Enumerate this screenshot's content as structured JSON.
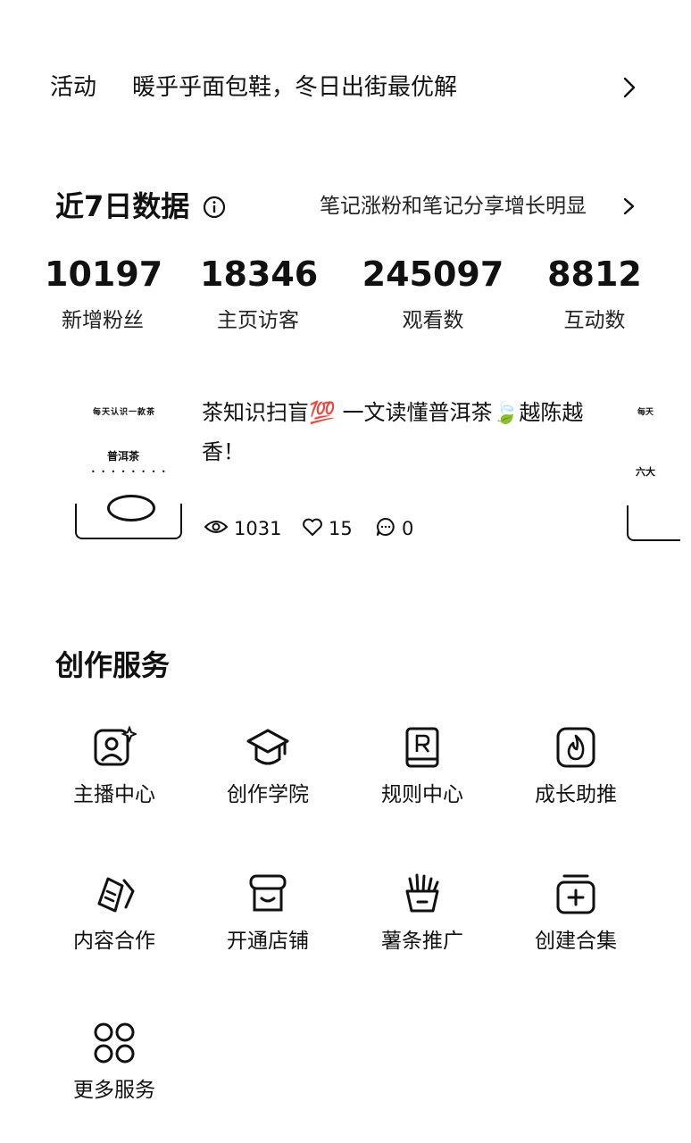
{
  "activity": {
    "tag": "活动",
    "text": "暖乎乎面包鞋，冬日出街最优解"
  },
  "data_panel": {
    "title": "近7日数据",
    "hint": "笔记涨粉和笔记分享增长明显",
    "stats": [
      {
        "value": "10197",
        "label": "新增粉丝"
      },
      {
        "value": "18346",
        "label": "主页访客"
      },
      {
        "value": "245097",
        "label": "观看数"
      },
      {
        "value": "8812",
        "label": "互动数"
      }
    ]
  },
  "note": {
    "title": "茶知识扫盲💯 一文读懂普洱茶🍃越陈越香！",
    "thumb_line1": "每天认识一款茶",
    "thumb_line2": "普洱茶",
    "thumb_dots": "• • • •  • • • •",
    "views": "1031",
    "likes": "15",
    "comments": "0",
    "next_thumb_line1": "每天",
    "next_thumb_line2": "六大"
  },
  "services": {
    "title": "创作服务",
    "items": [
      {
        "label": "主播中心",
        "icon": "host-center-icon"
      },
      {
        "label": "创作学院",
        "icon": "graduation-cap-icon"
      },
      {
        "label": "规则中心",
        "icon": "rule-book-icon"
      },
      {
        "label": "成长助推",
        "icon": "flame-icon"
      },
      {
        "label": "内容合作",
        "icon": "content-cooperation-icon"
      },
      {
        "label": "开通店铺",
        "icon": "shop-icon"
      },
      {
        "label": "薯条推广",
        "icon": "fries-icon"
      },
      {
        "label": "创建合集",
        "icon": "add-collection-icon"
      },
      {
        "label": "更多服务",
        "icon": "more-services-icon"
      }
    ]
  }
}
